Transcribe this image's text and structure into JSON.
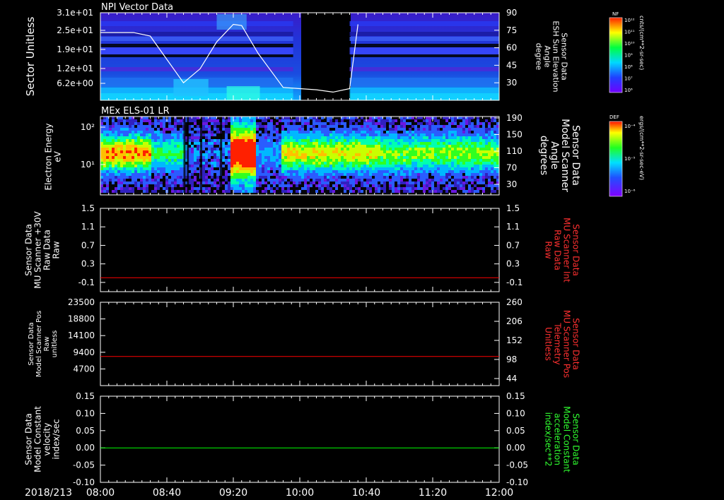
{
  "chart_data": [
    {
      "type": "heatmap",
      "title": "NPI Vector Data",
      "ylabel": "Sector Unitless",
      "y_ticks": [
        "3.1e+01",
        "2.5e+01",
        "1.9e+01",
        "1.2e+01",
        "6.2e+00"
      ],
      "y2label": [
        "Sensor Data",
        "ESH Sun Elevation",
        "Angle",
        "degree"
      ],
      "y2_ticks": [
        "90",
        "75",
        "60",
        "45",
        "30"
      ],
      "y2lim": [
        15,
        90
      ],
      "colorbar": {
        "label": "NF",
        "units": "cnts/(cm**2-sr-sec)",
        "ticks": [
          "10¹²",
          "10¹¹",
          "10¹⁰",
          "10⁹",
          "10⁸",
          "10⁷",
          "10⁶"
        ]
      },
      "data_gap": {
        "start": "09:56",
        "end": "10:30"
      },
      "series": [
        {
          "x": [
            "08:00",
            "08:20",
            "08:30",
            "08:40",
            "08:50",
            "09:00",
            "09:10",
            "09:20",
            "09:25",
            "09:35",
            "09:50",
            "10:00",
            "10:10",
            "10:20",
            "10:30",
            "10:35"
          ],
          "values": [
            73,
            73,
            70,
            50,
            30,
            42,
            65,
            80,
            79,
            55,
            26,
            25,
            24,
            22,
            25,
            80
          ]
        }
      ]
    },
    {
      "type": "heatmap",
      "title": "MEx ELS-01 LR",
      "ylabel": [
        "Electron Energy",
        "eV"
      ],
      "y_ticks": [
        "10²",
        "10¹"
      ],
      "y2label": [
        "Sensor Data",
        "Model Scanner",
        "Angle",
        "degrees"
      ],
      "y2_ticks": [
        "190",
        "150",
        "110",
        "70",
        "30"
      ],
      "colorbar": {
        "label": "DEF",
        "units": "ergs/(cm**2-sr-sec-eV)",
        "ticks": [
          "10⁻⁴",
          "10⁻⁵",
          "10⁻⁶"
        ]
      }
    },
    {
      "type": "line",
      "ylabel": [
        "Sensor Data",
        "MU Scanner +30V",
        "Raw Data",
        "Raw"
      ],
      "y_ticks": [
        "1.5",
        "1.1",
        "0.7",
        "0.3",
        "-0.1"
      ],
      "ylim": [
        -0.3,
        1.5
      ],
      "y2label": [
        "Sensor Data",
        "MU Scanner Int",
        "Raw Data",
        "Raw"
      ],
      "y2_ticks": [
        "1.5",
        "1.1",
        "0.7",
        "0.3",
        "-0.1"
      ],
      "series": [
        {
          "color": "#ff0000",
          "x": [
            "08:00",
            "12:00"
          ],
          "values": [
            0.0,
            0.0
          ]
        }
      ]
    },
    {
      "type": "line",
      "ylabel": [
        "Sensor Data",
        "Model Scanner Pos",
        "Raw",
        "unitless"
      ],
      "y_ticks": [
        "23500",
        "18800",
        "14100",
        "9400",
        "4700"
      ],
      "ylim": [
        0,
        23500
      ],
      "y2label": [
        "Sensor Data",
        "MU Scanner Pos",
        "Telemetry",
        "Unitless"
      ],
      "y2_ticks": [
        "260",
        "206",
        "152",
        "98",
        "44"
      ],
      "series": [
        {
          "color": "#ff0000",
          "x": [
            "08:00",
            "12:00"
          ],
          "values": [
            8230,
            8230
          ]
        }
      ]
    },
    {
      "type": "line",
      "ylabel": [
        "Sensor Data",
        "Model Constant",
        "velocity",
        "index/sec"
      ],
      "y_ticks": [
        "0.15",
        "0.10",
        "0.05",
        "0.00",
        "-0.05",
        "-0.10"
      ],
      "ylim": [
        -0.1,
        0.15
      ],
      "y2label": [
        "Sensor Data",
        "Model Constant",
        "acceleration",
        "index/sec**2"
      ],
      "y2_ticks": [
        "0.15",
        "0.10",
        "0.05",
        "0.00",
        "-0.05",
        "-0.10"
      ],
      "series": [
        {
          "color": "#00ff00",
          "x": [
            "08:00",
            "12:00"
          ],
          "values": [
            0.0,
            0.0
          ]
        }
      ]
    }
  ],
  "x_axis": {
    "date": "2018/213",
    "ticks": [
      "08:00",
      "08:40",
      "09:20",
      "10:00",
      "10:40",
      "11:20",
      "12:00"
    ],
    "range": [
      "08:00",
      "12:00"
    ]
  },
  "colors": {
    "background": "#000000",
    "frame": "#ffffff",
    "red_label": "#ff3030",
    "green_label": "#30ff30"
  }
}
